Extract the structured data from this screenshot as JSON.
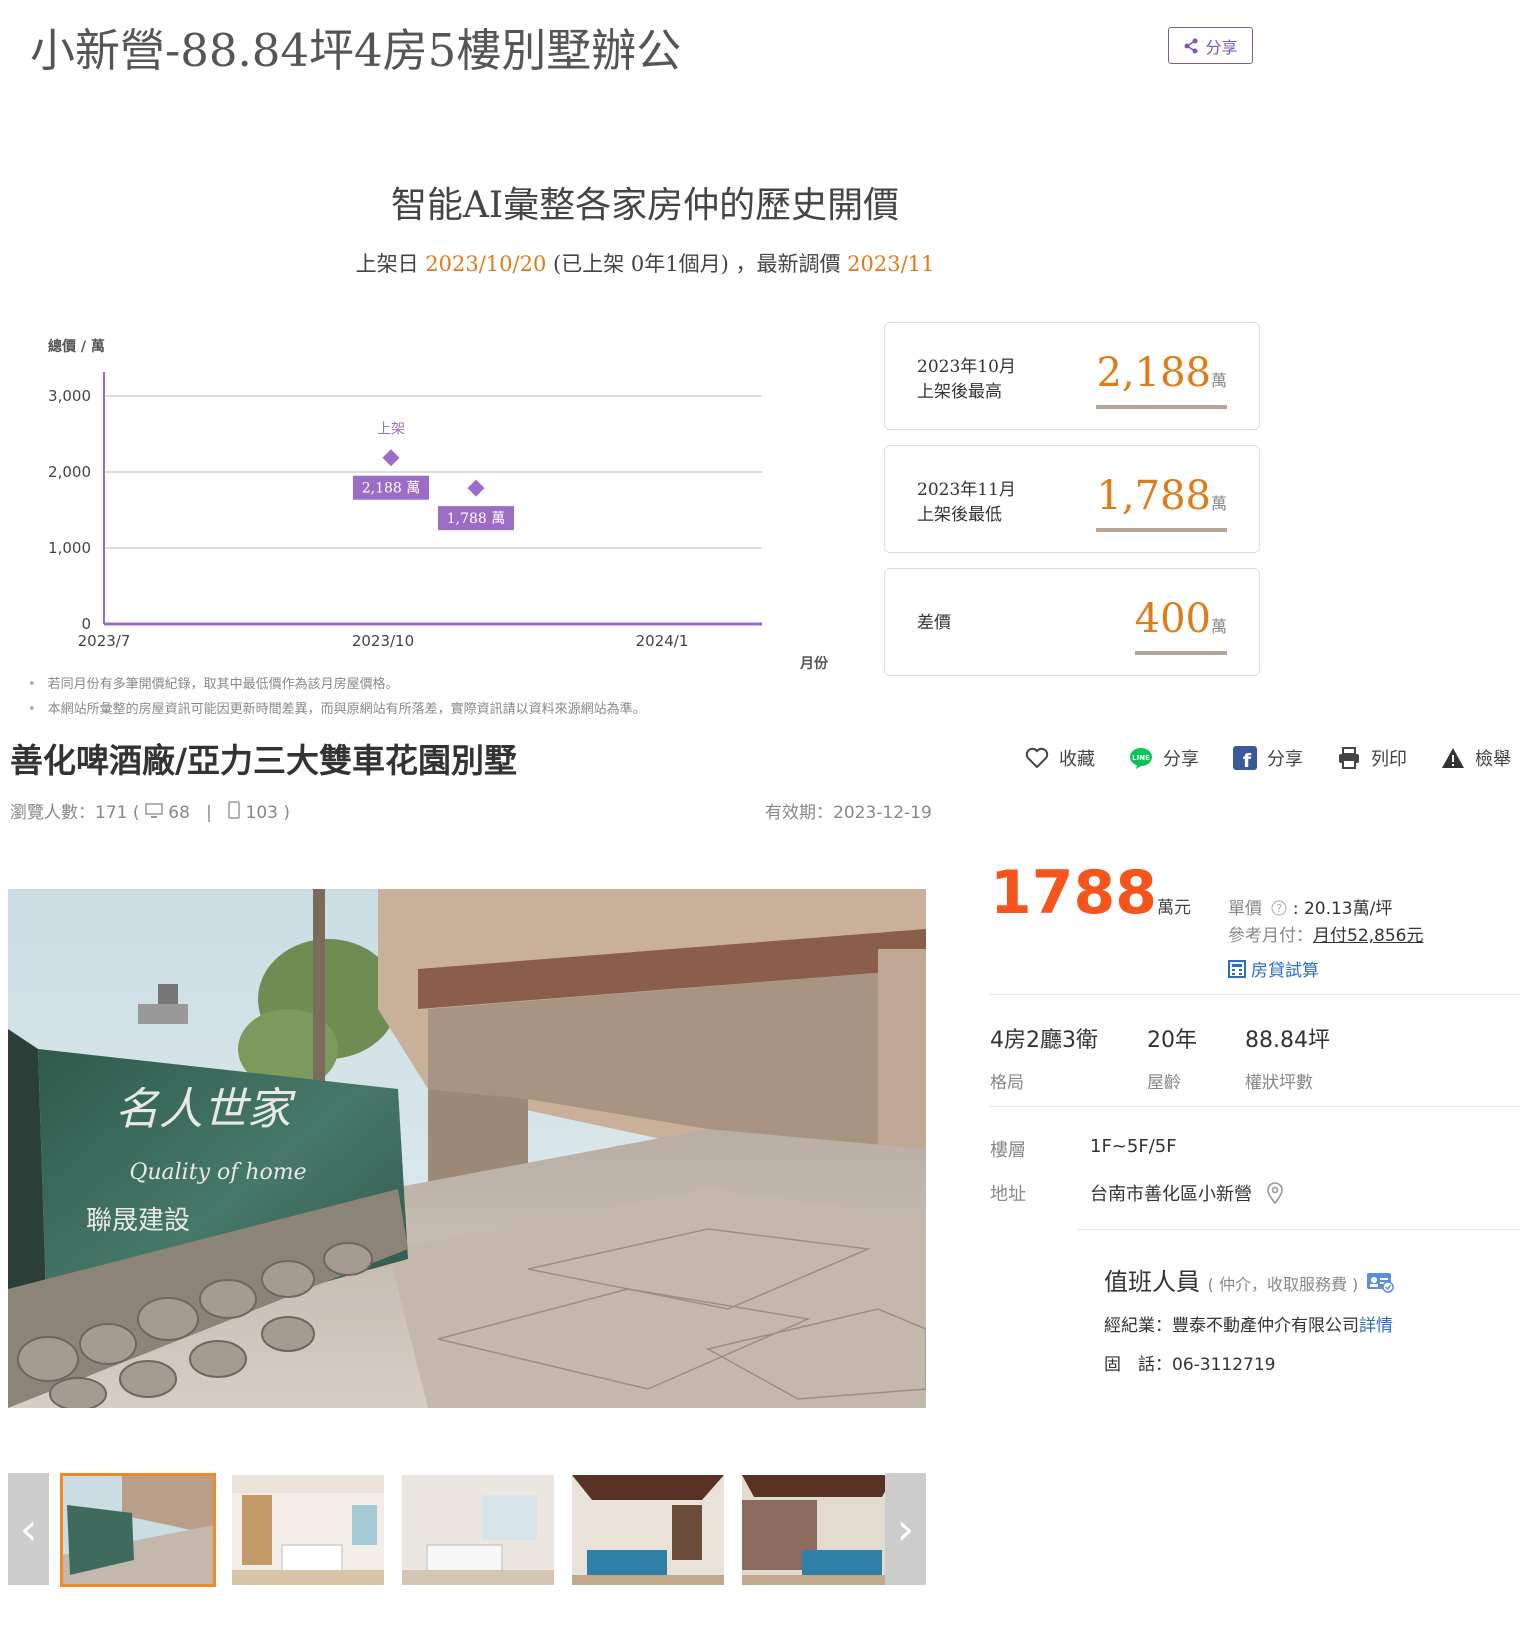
{
  "header": {
    "title": "小新營-88.84坪4房5樓別墅辦公",
    "share_label": "分享"
  },
  "ai": {
    "title": "智能AI彙整各家房仲的歷史開價",
    "sub_prefix": "上架日",
    "list_date": "2023/10/20",
    "sub_mid": "(已上架 0年1個月) ，最新調價",
    "latest_date": "2023/11"
  },
  "chart_data": {
    "type": "scatter",
    "ylabel": "總價 / 萬",
    "xlabel": "月份",
    "ylim": [
      0,
      3000
    ],
    "yticks": [
      "3,000",
      "2,000",
      "1,000",
      "0"
    ],
    "xticks": [
      "2023/7",
      "2023/10",
      "2024/1"
    ],
    "grid": true,
    "points": [
      {
        "x": "2023/10",
        "y": 2188,
        "label": "2,188 萬",
        "annotation": "上架"
      },
      {
        "x": "2023/11",
        "y": 1788,
        "label": "1,788 萬",
        "annotation": ""
      }
    ],
    "color": "#9b6dc6"
  },
  "stats": [
    {
      "label1": "2023年10月",
      "label2": "上架後最高",
      "value": "2,188",
      "unit": "萬"
    },
    {
      "label1": "2023年11月",
      "label2": "上架後最低",
      "value": "1,788",
      "unit": "萬"
    },
    {
      "label1": "差價",
      "label2": "",
      "value": "400",
      "unit": "萬"
    }
  ],
  "notes": [
    "若同月份有多筆開價紀錄，取其中最低價作為該月房屋價格。",
    "本網站所彙整的房屋資訊可能因更新時間差異，而與原網站有所落差，實際資訊請以資料來源網站為準。"
  ],
  "listing": {
    "title": "善化啤酒廠/亞力三大雙車花園別墅",
    "actions": [
      "收藏",
      "分享",
      "分享",
      "列印",
      "檢舉"
    ],
    "views_label": "瀏覽人數：171 (",
    "views_pc": "68",
    "views_sep": "|",
    "views_mobile": "103 )",
    "valid": "有效期：2023-12-19"
  },
  "price": {
    "amount": "1788",
    "unit": "萬元",
    "unit_price_label": "單價",
    "unit_price_value": ": 20.13萬/坪",
    "monthly_label": "參考月付：",
    "monthly_value": "月付52,856元",
    "calc_label": "房貸試算"
  },
  "specs": [
    {
      "value": "4房2廳3衛",
      "label": "格局"
    },
    {
      "value": "20年",
      "label": "屋齡"
    },
    {
      "value": "88.84坪",
      "label": "權狀坪數"
    }
  ],
  "details": {
    "floor_label": "樓層",
    "floor_value": "1F~5F/5F",
    "addr_label": "地址",
    "addr_value": "台南市善化區小新營"
  },
  "agent": {
    "heading": "值班人員",
    "heading_note": "( 仲介，收取服務費 )",
    "company_label": "經紀業：豐泰不動產仲介有限公司",
    "company_link": "詳情",
    "phone_label": "固　話：",
    "phone": "06-3112719"
  },
  "gallery": {
    "sign_text": "名人世家",
    "sign_sub": "Quality of home",
    "sign_brand": "聯晟建設"
  }
}
